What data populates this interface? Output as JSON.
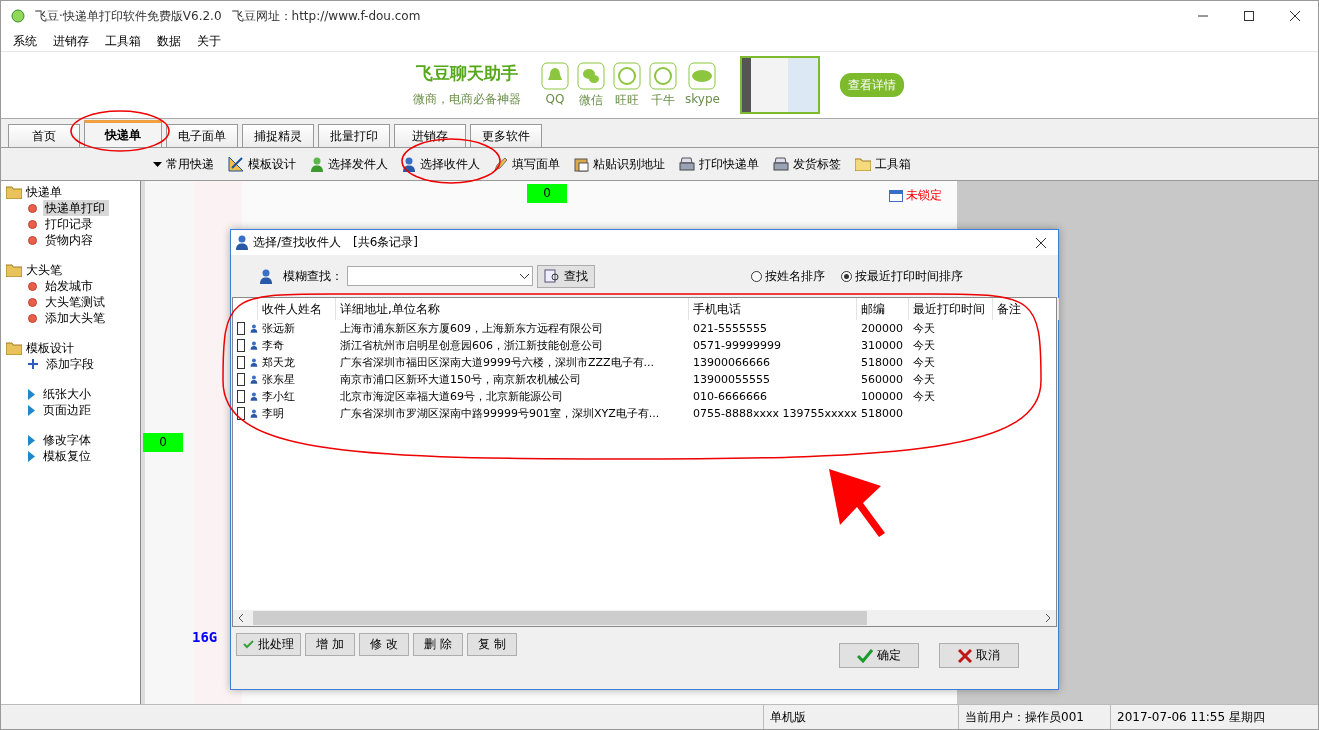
{
  "window": {
    "title": "飞豆·快递单打印软件免费版V6.2.0",
    "website": "飞豆网址：http://www.f-dou.com"
  },
  "menu": [
    "系统",
    "进销存",
    "工具箱",
    "数据",
    "关于"
  ],
  "banner": {
    "title": "飞豆聊天助手",
    "subtitle": "微商，电商必备神器",
    "apps": [
      "QQ",
      "微信",
      "旺旺",
      "千牛",
      "skype"
    ],
    "button": "查看详情"
  },
  "tabs": [
    {
      "label": "首页",
      "selected": false
    },
    {
      "label": "快递单",
      "selected": true
    },
    {
      "label": "电子面单",
      "selected": false
    },
    {
      "label": "捕捉精灵",
      "selected": false
    },
    {
      "label": "批量打印",
      "selected": false
    },
    {
      "label": "进销存",
      "selected": false
    },
    {
      "label": "更多软件",
      "selected": false
    }
  ],
  "toolbar": [
    {
      "label": "常用快递",
      "kind": "dropdown"
    },
    {
      "label": "模板设计",
      "kind": "ruler"
    },
    {
      "label": "选择发件人",
      "kind": "sender"
    },
    {
      "label": "选择收件人",
      "kind": "recipient"
    },
    {
      "label": "填写面单",
      "kind": "pencil"
    },
    {
      "label": "粘贴识别地址",
      "kind": "clipboard"
    },
    {
      "label": "打印快递单",
      "kind": "printer"
    },
    {
      "label": "发货标签",
      "kind": "printer"
    },
    {
      "label": "工具箱",
      "kind": "folder"
    }
  ],
  "sidebar": [
    {
      "label": "快递单",
      "children": [
        {
          "label": "快递单打印",
          "kind": "dot",
          "selected": true
        },
        {
          "label": "打印记录",
          "kind": "dot",
          "selected": false
        },
        {
          "label": "货物内容",
          "kind": "dot",
          "selected": false
        }
      ]
    },
    {
      "label": "大头笔",
      "children": [
        {
          "label": "始发城市",
          "kind": "dot",
          "selected": false
        },
        {
          "label": "大头笔测试",
          "kind": "dot",
          "selected": false
        },
        {
          "label": "添加大头笔",
          "kind": "dot",
          "selected": false
        }
      ]
    },
    {
      "label": "模板设计",
      "children": [
        {
          "label": "添加字段",
          "kind": "plus",
          "selected": false
        },
        {
          "label": "纸张大小",
          "kind": "arrow",
          "selected": false
        },
        {
          "label": "页面边距",
          "kind": "arrow",
          "selected": false
        },
        {
          "label": "修改字体",
          "kind": "arrow",
          "selected": false
        },
        {
          "label": "模板复位",
          "kind": "arrow",
          "selected": false
        }
      ]
    }
  ],
  "canvas": {
    "counters": [
      "0",
      "0"
    ],
    "lock_label": "未锁定",
    "field_text": "16G"
  },
  "dialog": {
    "title": "选择/查找收件人",
    "record_count": "[共6条记录]",
    "search_label": "模糊查找：",
    "search_button": "查找",
    "sort_options": [
      {
        "label": "按姓名排序",
        "selected": false
      },
      {
        "label": "按最近打印时间排序",
        "selected": true
      }
    ],
    "columns": [
      "收件人姓名",
      "详细地址,单位名称",
      "手机电话",
      "邮编",
      "最近打印时间",
      "备注"
    ],
    "rows": [
      {
        "checked": false,
        "name": "张远新",
        "address": "上海市浦东新区东方厦609，上海新东方远程有限公司",
        "phone": "021-5555555",
        "zip": "200000",
        "last_printed": "今天"
      },
      {
        "checked": false,
        "name": "李奇",
        "address": "浙江省杭州市启明星创意园606，浙江新技能创意公司",
        "phone": "0571-99999999",
        "zip": "310000",
        "last_printed": "今天"
      },
      {
        "checked": false,
        "name": "郑天龙",
        "address": "广东省深圳市福田区深南大道9999号六楼，深圳市ZZZ电子有...",
        "phone": "13900066666",
        "zip": "518000",
        "last_printed": "今天"
      },
      {
        "checked": false,
        "name": "张东星",
        "address": "南京市浦口区新环大道150号，南京新农机械公司",
        "phone": "13900055555",
        "zip": "560000",
        "last_printed": "今天"
      },
      {
        "checked": false,
        "name": "李小红",
        "address": "北京市海淀区幸福大道69号，北京新能源公司",
        "phone": "010-6666666",
        "zip": "100000",
        "last_printed": "今天"
      },
      {
        "checked": false,
        "name": "李明",
        "address": "广东省深圳市罗湖区深南中路99999号901室，深圳XYZ电子有...",
        "phone": "0755-8888xxxx 139755xxxxx",
        "zip": "518000"
      }
    ],
    "actions": [
      "批处理",
      "增 加",
      "修 改",
      "删 除",
      "复 制"
    ],
    "ok": "确定",
    "cancel": "取消"
  },
  "status_bar": [
    "单机版",
    "当前用户：操作员001",
    "2017-07-06 11:55 星期四"
  ]
}
